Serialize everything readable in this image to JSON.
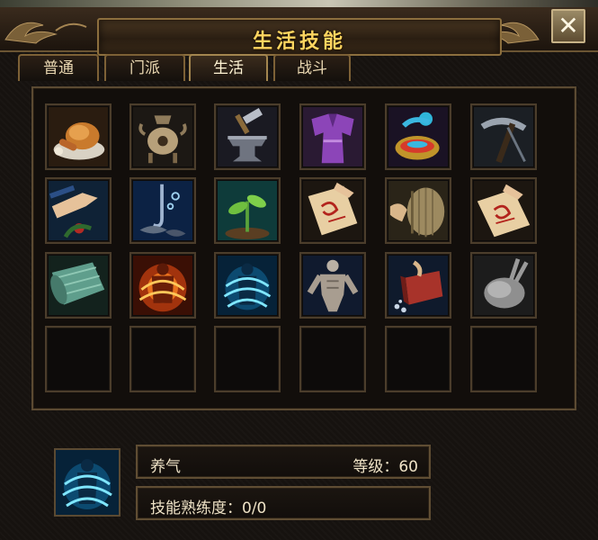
{
  "window": {
    "title": "生活技能",
    "close_symbol": "✕"
  },
  "tabs": [
    {
      "label": "普通",
      "active": false
    },
    {
      "label": "门派",
      "active": false
    },
    {
      "label": "生活",
      "active": true
    },
    {
      "label": "战斗",
      "active": false
    }
  ],
  "skills": [
    {
      "icon": "roast-chicken-icon"
    },
    {
      "icon": "incense-burner-icon"
    },
    {
      "icon": "anvil-hammer-icon"
    },
    {
      "icon": "purple-robe-icon"
    },
    {
      "icon": "teapot-icon"
    },
    {
      "icon": "pickaxe-icon"
    },
    {
      "icon": "herb-picking-icon"
    },
    {
      "icon": "fishing-icon"
    },
    {
      "icon": "seedling-icon"
    },
    {
      "icon": "scroll-writing-icon"
    },
    {
      "icon": "grindstone-icon"
    },
    {
      "icon": "scroll-red-seal-icon"
    },
    {
      "icon": "cloth-bolt-icon"
    },
    {
      "icon": "fire-aura-icon"
    },
    {
      "icon": "blue-aura-icon"
    },
    {
      "icon": "muscle-body-icon"
    },
    {
      "icon": "red-box-icon"
    },
    {
      "icon": "plucked-chicken-icon"
    }
  ],
  "empty_slots": 6,
  "selected_skill": {
    "icon": "blue-aura-icon",
    "name": "养气",
    "level_text": "等级：60",
    "proficiency_text": "技能熟练度：0/0"
  },
  "colors": {
    "title": "#ffd560",
    "frame": "#7d6136",
    "text": "#efe3c7"
  }
}
